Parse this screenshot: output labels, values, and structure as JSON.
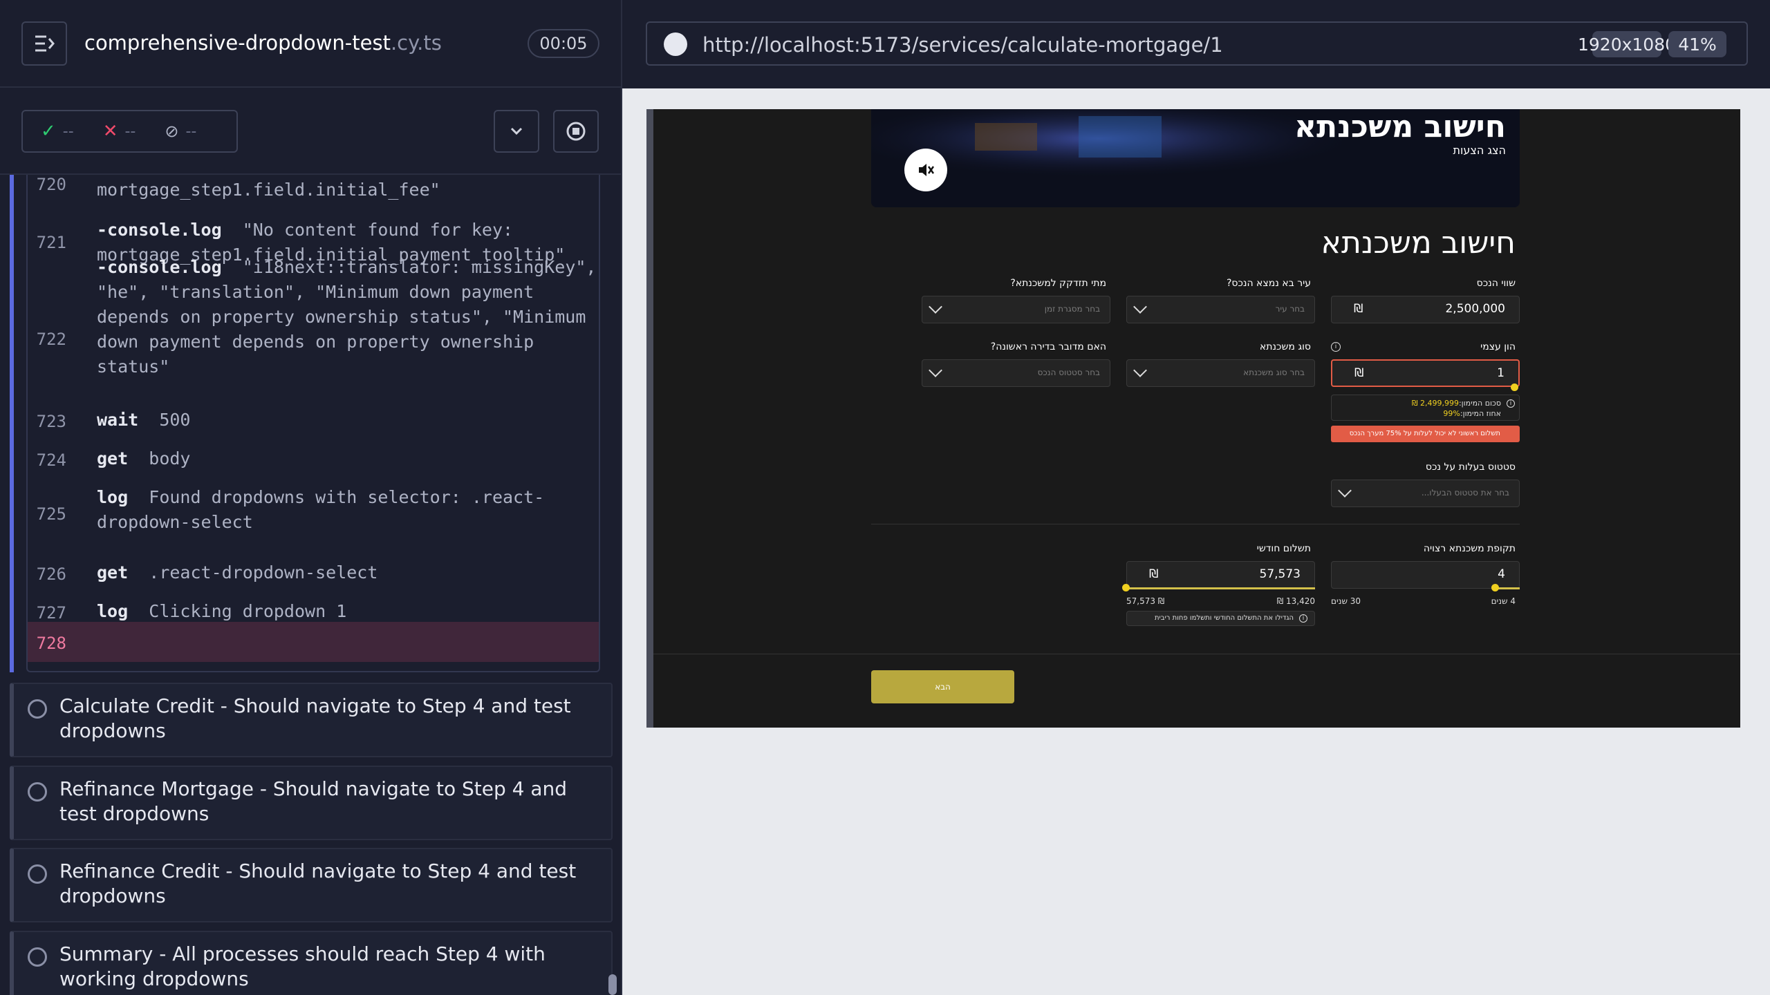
{
  "spec": {
    "name": "comprehensive-dropdown-test",
    "ext": ".cy.ts",
    "timer": "00:05"
  },
  "stats": {
    "passed": "--",
    "failed": "--",
    "pending": "--"
  },
  "log": [
    {
      "num": "720",
      "text": "mortgage_step1.field.initial_fee\""
    },
    {
      "num": "721",
      "cmd": "-console.log",
      "text": "\"No content found for key:\nmortgage_step1.field.initial_payment_tooltip\""
    },
    {
      "num": "722",
      "cmd": "-console.log",
      "text": "\"i18next::translator: missingKey\",\n\"he\", \"translation\", \"Minimum down payment\ndepends on property ownership status\", \"Minimum\ndown payment depends on property ownership\nstatus\""
    },
    {
      "num": "723",
      "cmd": "wait",
      "text": "500"
    },
    {
      "num": "724",
      "cmd": "get",
      "text": "body"
    },
    {
      "num": "725",
      "cmd": "log",
      "text": "Found dropdowns with selector: .react-\ndropdown-select"
    },
    {
      "num": "726",
      "cmd": "get",
      "text": ".react-dropdown-select"
    },
    {
      "num": "727",
      "cmd": "log",
      "text": "Clicking dropdown 1"
    },
    {
      "num": "728",
      "text": ""
    }
  ],
  "tests": [
    "Calculate Credit - Should navigate to Step 4 and test dropdowns",
    "Refinance Mortgage - Should navigate to Step 4 and test dropdowns",
    "Refinance Credit - Should navigate to Step 4 and test dropdowns",
    "Summary - All processes should reach Step 4 with working dropdowns"
  ],
  "browser": {
    "url": "http://localhost:5173/services/calculate-mortgage/1",
    "viewport": "1920x1080",
    "zoom": "41%"
  },
  "app": {
    "banner_title": "חישוב משכנתא",
    "banner_sub": "הצג הצעות",
    "page_title": "חישוב משכנתא",
    "fields": {
      "property_value": {
        "label": "שווי הנכס",
        "value": "2,500,000",
        "currency": "₪"
      },
      "city": {
        "label": "עיר בא נמצא הנכס?",
        "placeholder": "בחר עיר"
      },
      "when": {
        "label": "מתי תזדקק למשכנתא?",
        "placeholder": "בחר מסגרת זמן"
      },
      "equity": {
        "label": "הון עצמי",
        "value": "1",
        "currency": "₪"
      },
      "mortgage_type": {
        "label": "סוג משכנתא",
        "placeholder": "בחר סוג משכנתא"
      },
      "first_home": {
        "label": "האם מדובר בדירה ראשונה?",
        "placeholder": "בחר סטטוס הנכס"
      },
      "ownership": {
        "label": "סטטוס בעלות על נכס",
        "placeholder": "בחר את סטטוס הבעלו..."
      },
      "period": {
        "label": "תקופת משכנתא רצויה",
        "value": "4",
        "min": "4 שנים",
        "max": "30 שנים"
      },
      "monthly": {
        "label": "תשלום חודשי",
        "value": "57,573",
        "currency": "₪",
        "min": "13,420 ₪",
        "max": "57,573 ₪"
      }
    },
    "equity_note_line1_prefix": "סכום המימון:",
    "equity_note_amount": "2,499,999 ₪",
    "equity_note_line2_prefix": "אחוז המימון:",
    "equity_note_pct": "99%",
    "error": "תשלום ראשוני לא יכול לעלות על 75% מערך הנכס",
    "monthly_note": "הגדילו את התשלום החודשי ותשלמו פחות ריבית",
    "next": "הבא"
  }
}
